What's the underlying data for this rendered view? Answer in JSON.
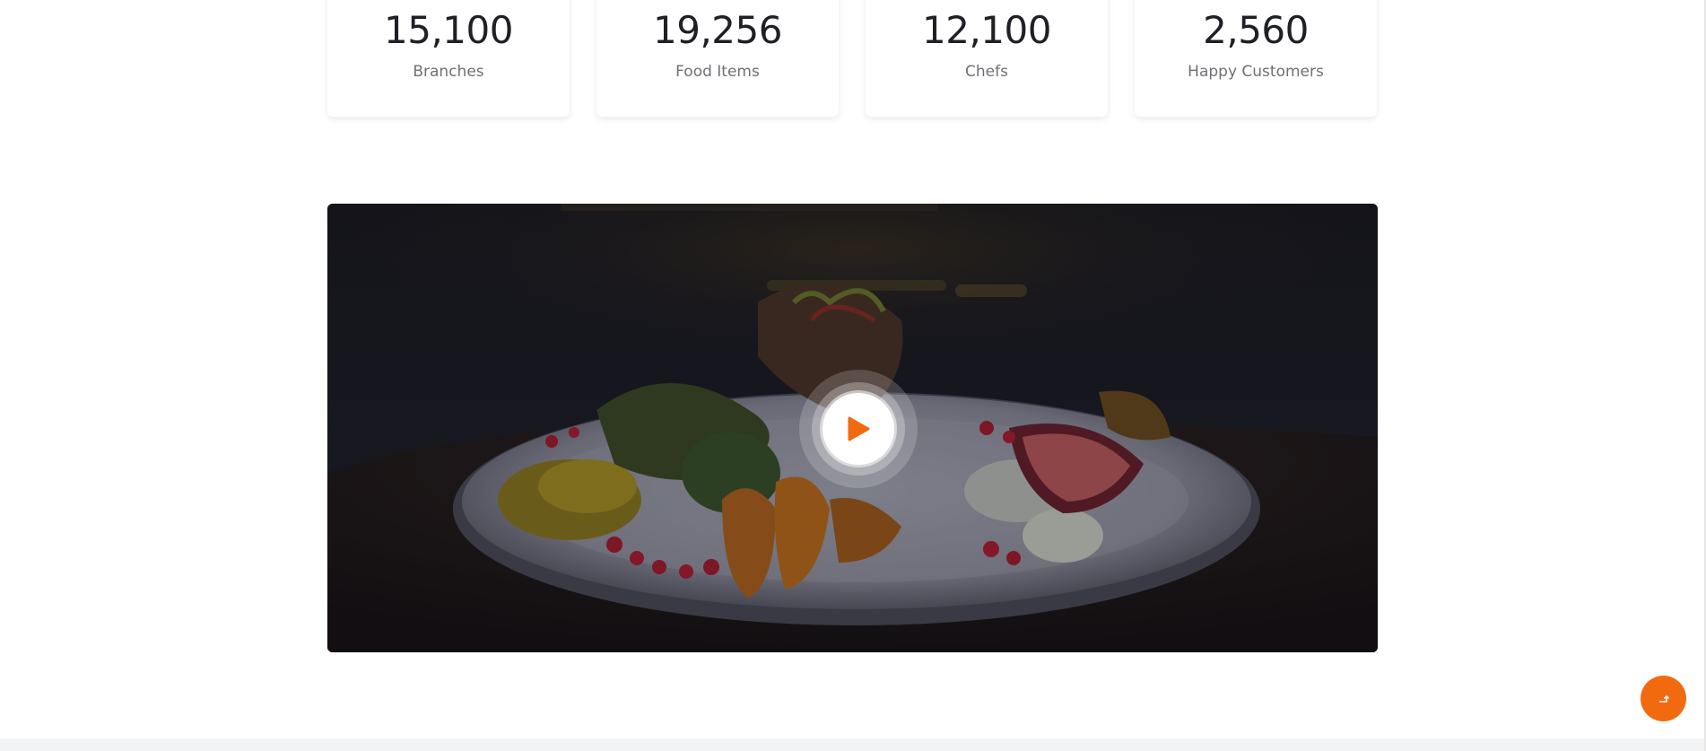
{
  "stats": [
    {
      "value": "15,100",
      "label": "Branches"
    },
    {
      "value": "19,256",
      "label": "Food Items"
    },
    {
      "value": "12,100",
      "label": "Chefs"
    },
    {
      "value": "2,560",
      "label": "Happy Customers"
    }
  ],
  "video": {
    "play_icon": "play-icon"
  },
  "back_to_top": {
    "icon": "arrow-up-icon"
  },
  "colors": {
    "accent": "#f26a10",
    "text_dark": "#1f2025",
    "text_muted": "#6e7074"
  }
}
